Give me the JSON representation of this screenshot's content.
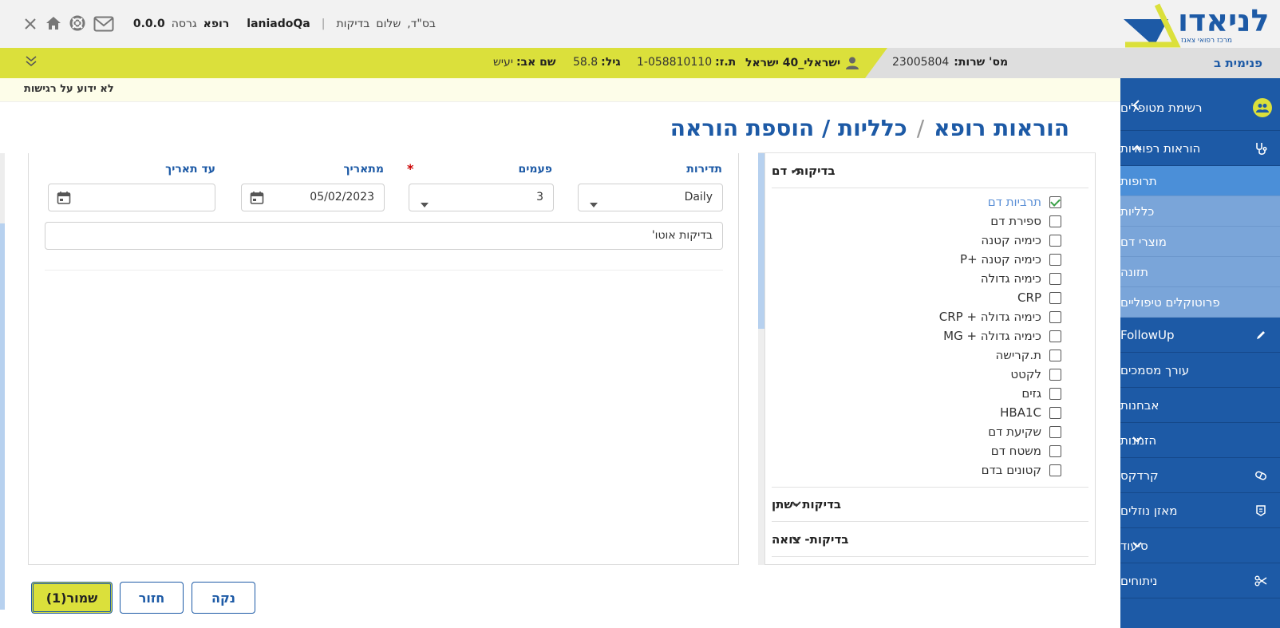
{
  "topbar": {
    "logo_text": "לניאדו",
    "logo_sub": "מרכז רפואי צאנז",
    "bsd": "בס\"ד,",
    "greeting": "שלום",
    "user_role_label": "בדיקות",
    "separator": "|",
    "username": "laniadoQa",
    "role": "רופא",
    "version_label": "גרסה",
    "version": "0.0.0"
  },
  "patient": {
    "department": "פנימית ב",
    "service_label": "מס' שרות:",
    "service_no": "23005804",
    "name": "ישראלי_40 ישראל",
    "id_label": "ת.ז:",
    "id": "1-058810110",
    "age_label": "גיל:",
    "age": "58.8",
    "father_label": "שם אב:",
    "father": "יעיש"
  },
  "allergy": {
    "text": "לא ידוע על רגישות"
  },
  "sidebar": {
    "items": [
      {
        "label": "רשימת מטופלים"
      },
      {
        "label": "הוראות רפואיות"
      },
      {
        "label": "תרופות"
      },
      {
        "label": "כלליות"
      },
      {
        "label": "מוצרי דם"
      },
      {
        "label": "תזונה"
      },
      {
        "label": "פרוטוקלים טיפוליים"
      },
      {
        "label": "FollowUp"
      },
      {
        "label": "עורך מסמכים"
      },
      {
        "label": "אבחנות"
      },
      {
        "label": "הזמנות"
      },
      {
        "label": "קרדקס"
      },
      {
        "label": "מאזן נוזלים"
      },
      {
        "label": "סיעוד"
      },
      {
        "label": "ניתוחים"
      }
    ]
  },
  "page": {
    "breadcrumb_1": "הוראות רופא",
    "breadcrumb_sep": "/",
    "breadcrumb_2": "כלליות / הוספת הוראה"
  },
  "form": {
    "frequency_label": "תדירות",
    "frequency_value": "Daily",
    "times_label": "פעמים",
    "times_required": "*",
    "times_value": "3",
    "from_label": "מתאריך",
    "from_value": "05/02/2023",
    "to_label": "עד תאריך",
    "to_value": "",
    "note_value": "בדיקות אוטו'"
  },
  "categories": {
    "blood": {
      "title": "בדיקות- דם",
      "items": [
        {
          "label": "תרביות דם",
          "checked": true
        },
        {
          "label": "ספירת דם",
          "checked": false
        },
        {
          "label": "כימיה קטנה",
          "checked": false
        },
        {
          "label": "כימיה קטנה +P",
          "checked": false
        },
        {
          "label": "כימיה גדולה",
          "checked": false
        },
        {
          "label": "CRP",
          "checked": false
        },
        {
          "label": "כימיה גדולה + CRP",
          "checked": false
        },
        {
          "label": "כימיה גדולה + MG",
          "checked": false
        },
        {
          "label": "ת.קרישה",
          "checked": false
        },
        {
          "label": "לקטט",
          "checked": false
        },
        {
          "label": "גזים",
          "checked": false
        },
        {
          "label": "HBA1C",
          "checked": false
        },
        {
          "label": "שקיעת דם",
          "checked": false
        },
        {
          "label": "משטח דם",
          "checked": false
        },
        {
          "label": "קטונים בדם",
          "checked": false
        }
      ]
    },
    "urine": {
      "title": "בדיקות -שתן"
    },
    "stool": {
      "title": "בדיקות- צואה"
    }
  },
  "buttons": {
    "save": "שמור(1)",
    "back": "חזור",
    "clear": "נקה"
  },
  "colors": {
    "brand_blue": "#1d5aa6",
    "brand_yellow": "#dbe03b",
    "submenu": "#7aa5d9",
    "submenu_active": "#4b8fd8"
  }
}
